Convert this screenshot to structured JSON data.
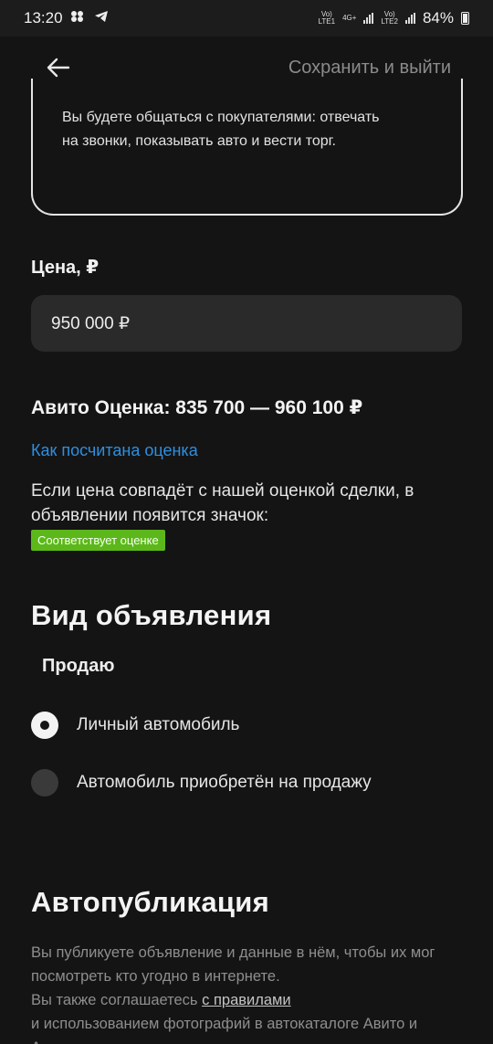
{
  "status_bar": {
    "time": "13:20",
    "sim1": "LTE1",
    "sim2": "LTE2",
    "network": "4G+",
    "battery": "84%"
  },
  "topbar": {
    "back_icon": "arrow-left-icon",
    "save_exit_label": "Сохранить и выйти"
  },
  "info_card": {
    "text": "Вы будете общаться с покупателями: отвечать на звонки, показывать авто и вести торг."
  },
  "price": {
    "label": "Цена, ₽",
    "value": "950 000 ₽"
  },
  "estimate": {
    "text": "Авито Оценка: 835 700 — 960 100 ₽",
    "link": "Как посчитана оценка",
    "note": "Если цена совпадёт с нашей оценкой сделки, в объявлении появится значок:",
    "badge": "Соответствует оценке",
    "badge_color": "#5cb81a"
  },
  "listing_type": {
    "title": "Вид объявления",
    "subtitle": "Продаю",
    "options": [
      {
        "label": "Личный автомобиль",
        "selected": true
      },
      {
        "label": "Автомобиль приобретён на продажу",
        "selected": false
      }
    ]
  },
  "autopublish": {
    "title": "Автопубликация",
    "text_1": "Вы публикуете объявление и данные в нём, чтобы их мог посмотреть кто угодно в интернете.",
    "text_2": "Вы также соглашаетесь",
    "link": "с правилами",
    "text_3": "и использованием фотографий в автокаталоге Авито и Автотеке"
  },
  "colors": {
    "background": "#141414",
    "link": "#2e8fe0",
    "field": "#2a2a2a"
  }
}
